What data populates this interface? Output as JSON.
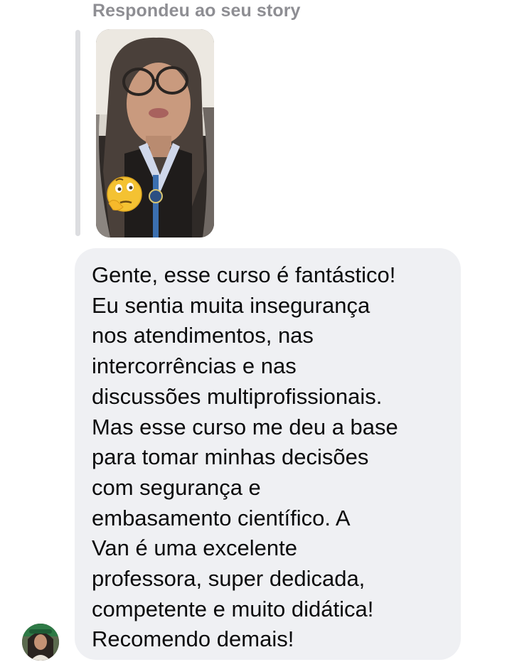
{
  "reply_label": "Respondeu ao seu story",
  "story": {
    "thumbnail": "story-video-thumbnail",
    "sticker": "thinking-face-emoji"
  },
  "message": {
    "lines": [
      "Gente, esse curso é fantástico!",
      "Eu sentia muita insegurança",
      "nos atendimentos, nas",
      "intercorrências e nas",
      "discussões multiprofissionais.",
      "Mas esse curso me deu a base",
      "para tomar minhas decisões",
      "com segurança e",
      "embasamento científico.  A",
      "Van é uma excelente",
      "professora, super dedicada,",
      "competente e muito didática!",
      "Recomendo demais!"
    ]
  },
  "sender": {
    "avatar": "user-avatar"
  },
  "colors": {
    "bubble_bg": "#eff0f3",
    "label_gray": "#8e8e93",
    "reply_bar": "#dcdde0"
  }
}
